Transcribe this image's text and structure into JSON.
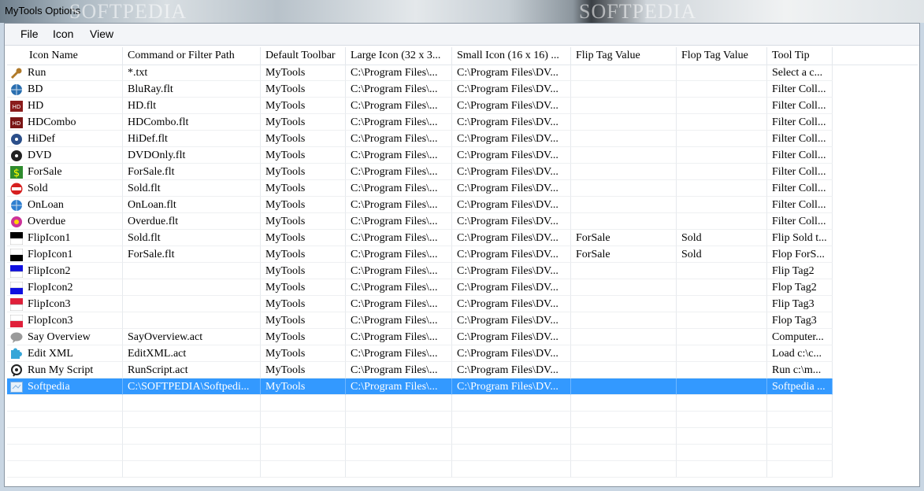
{
  "window": {
    "title": "MyTools Options",
    "watermark": "SOFTPEDIA"
  },
  "menu": [
    "File",
    "Icon",
    "View"
  ],
  "columns": [
    "Icon Name",
    "Command or Filter Path",
    "Default Toolbar",
    "Large Icon (32 x 3...",
    "Small Icon (16 x 16) ...",
    "Flip Tag Value",
    "Flop Tag Value",
    "Tool Tip"
  ],
  "rows": [
    {
      "icon": "wrench-icon",
      "color": "#b07a2a",
      "name": "Run",
      "path": "*.txt",
      "toolbar": "MyTools",
      "large": "C:\\Program Files\\...",
      "small": "C:\\Program Files\\DV...",
      "flip": "",
      "flop": "",
      "tip": "Select a c..."
    },
    {
      "icon": "globe-icon",
      "color": "#2a6fb0",
      "name": "BD",
      "path": "BluRay.flt",
      "toolbar": "MyTools",
      "large": "C:\\Program Files\\...",
      "small": "C:\\Program Files\\DV...",
      "flip": "",
      "flop": "",
      "tip": "Filter Coll..."
    },
    {
      "icon": "hd-badge-icon",
      "color": "#8a1c1c",
      "name": "HD",
      "path": "HD.flt",
      "toolbar": "MyTools",
      "large": "C:\\Program Files\\...",
      "small": "C:\\Program Files\\DV...",
      "flip": "",
      "flop": "",
      "tip": "Filter Coll..."
    },
    {
      "icon": "hdcombo-badge-icon",
      "color": "#7a1515",
      "name": "HDCombo",
      "path": "HDCombo.flt",
      "toolbar": "MyTools",
      "large": "C:\\Program Files\\...",
      "small": "C:\\Program Files\\DV...",
      "flip": "",
      "flop": "",
      "tip": "Filter Coll..."
    },
    {
      "icon": "hidef-disc-icon",
      "color": "#2b4f8a",
      "name": "HiDef",
      "path": "HiDef.flt",
      "toolbar": "MyTools",
      "large": "C:\\Program Files\\...",
      "small": "C:\\Program Files\\DV...",
      "flip": "",
      "flop": "",
      "tip": "Filter Coll..."
    },
    {
      "icon": "dvd-disc-icon",
      "color": "#222222",
      "name": "DVD",
      "path": "DVDOnly.flt",
      "toolbar": "MyTools",
      "large": "C:\\Program Files\\...",
      "small": "C:\\Program Files\\DV...",
      "flip": "",
      "flop": "",
      "tip": "Filter Coll..."
    },
    {
      "icon": "dollar-icon",
      "color": "#2e8b2e",
      "name": "ForSale",
      "path": "ForSale.flt",
      "toolbar": "MyTools",
      "large": "C:\\Program Files\\...",
      "small": "C:\\Program Files\\DV...",
      "flip": "",
      "flop": "",
      "tip": "Filter Coll..."
    },
    {
      "icon": "sold-badge-icon",
      "color": "#d62020",
      "name": "Sold",
      "path": "Sold.flt",
      "toolbar": "MyTools",
      "large": "C:\\Program Files\\...",
      "small": "C:\\Program Files\\DV...",
      "flip": "",
      "flop": "",
      "tip": "Filter Coll..."
    },
    {
      "icon": "loan-globe-icon",
      "color": "#2f7fd0",
      "name": "OnLoan",
      "path": "OnLoan.flt",
      "toolbar": "MyTools",
      "large": "C:\\Program Files\\...",
      "small": "C:\\Program Files\\DV...",
      "flip": "",
      "flop": "",
      "tip": "Filter Coll..."
    },
    {
      "icon": "overdue-flower-icon",
      "color": "#cc3399",
      "name": "Overdue",
      "path": "Overdue.flt",
      "toolbar": "MyTools",
      "large": "C:\\Program Files\\...",
      "small": "C:\\Program Files\\DV...",
      "flip": "",
      "flop": "",
      "tip": "Filter Coll..."
    },
    {
      "icon": "flip-black-icon",
      "color": "#000000",
      "name": "FlipIcon1",
      "path": "Sold.flt",
      "toolbar": "MyTools",
      "large": "C:\\Program Files\\...",
      "small": "C:\\Program Files\\DV...",
      "flip": "ForSale",
      "flop": "Sold",
      "tip": "Flip Sold t..."
    },
    {
      "icon": "flop-black-icon",
      "color": "#000000",
      "name": "FlopIcon1",
      "path": "ForSale.flt",
      "toolbar": "MyTools",
      "large": "C:\\Program Files\\...",
      "small": "C:\\Program Files\\DV...",
      "flip": "ForSale",
      "flop": "Sold",
      "tip": "Flop ForS..."
    },
    {
      "icon": "flip-blue-icon",
      "color": "#1010e0",
      "name": "FlipIcon2",
      "path": "",
      "toolbar": "MyTools",
      "large": "C:\\Program Files\\...",
      "small": "C:\\Program Files\\DV...",
      "flip": "",
      "flop": "",
      "tip": "Flip Tag2"
    },
    {
      "icon": "flop-blue-icon",
      "color": "#1010e0",
      "name": "FlopIcon2",
      "path": "",
      "toolbar": "MyTools",
      "large": "C:\\Program Files\\...",
      "small": "C:\\Program Files\\DV...",
      "flip": "",
      "flop": "",
      "tip": "Flop Tag2"
    },
    {
      "icon": "flip-red-icon",
      "color": "#e0203a",
      "name": "FlipIcon3",
      "path": "",
      "toolbar": "MyTools",
      "large": "C:\\Program Files\\...",
      "small": "C:\\Program Files\\DV...",
      "flip": "",
      "flop": "",
      "tip": "Flip Tag3"
    },
    {
      "icon": "flop-red-icon",
      "color": "#e0203a",
      "name": "FlopIcon3",
      "path": "",
      "toolbar": "MyTools",
      "large": "C:\\Program Files\\...",
      "small": "C:\\Program Files\\DV...",
      "flip": "",
      "flop": "",
      "tip": "Flop Tag3"
    },
    {
      "icon": "speech-bubble-icon",
      "color": "#9a9a9a",
      "name": "Say Overview",
      "path": "SayOverview.act",
      "toolbar": "MyTools",
      "large": "C:\\Program Files\\...",
      "small": "C:\\Program Files\\DV...",
      "flip": "",
      "flop": "",
      "tip": "Computer..."
    },
    {
      "icon": "puzzle-icon",
      "color": "#35a6d8",
      "name": "Edit XML",
      "path": "EditXML.act",
      "toolbar": "MyTools",
      "large": "C:\\Program Files\\...",
      "small": "C:\\Program Files\\DV...",
      "flip": "",
      "flop": "",
      "tip": "Load c:\\c..."
    },
    {
      "icon": "script-run-icon",
      "color": "#222222",
      "name": "Run My Script",
      "path": "RunScript.act",
      "toolbar": "MyTools",
      "large": "C:\\Program Files\\...",
      "small": "C:\\Program Files\\DV...",
      "flip": "",
      "flop": "",
      "tip": "Run c:\\m..."
    },
    {
      "icon": "softpedia-icon",
      "color": "#7fb0e0",
      "name": "Softpedia",
      "path": "C:\\SOFTPEDIA\\Softpedi...",
      "toolbar": "MyTools",
      "large": "C:\\Program Files\\...",
      "small": "C:\\Program Files\\DV...",
      "flip": "",
      "flop": "",
      "tip": "Softpedia ...",
      "selected": true
    }
  ],
  "selection_color": "#3399ff"
}
